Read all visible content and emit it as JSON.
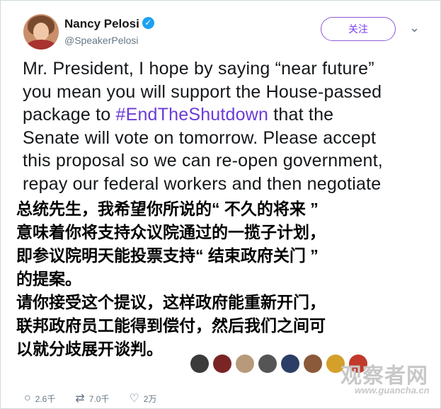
{
  "author": {
    "name": "Nancy Pelosi",
    "handle": "@SpeakerPelosi"
  },
  "follow_label": "关注",
  "tweet": {
    "line1": "Mr. President, I hope by saying “near future”",
    "line2": "you mean you will support the House-passed",
    "line3_pre": "package to ",
    "hashtag": "#EndTheShutdown",
    "line3_post": " that the",
    "line4": "Senate will vote on tomorrow. Please accept",
    "line5": "this proposal so we can re-open government,",
    "line6": "repay our federal workers and then negotiate"
  },
  "translation": [
    "总统先生，我希望你所说的“ 不久的将来 ”",
    "意味着你将支持众议院通过的一揽子计划，",
    "即参议院明天能投票支持“ 结束政府关门 ”",
    "的提案。",
    "请你接受这个提议，这样政府能重新开门，",
    "联邦政府员工能得到偿付，然后我们之间可",
    "以就分歧展开谈判。"
  ],
  "watermark": {
    "main": "观察者网",
    "sub": "www.guancha.cn"
  },
  "actions": {
    "reply_count": "2.6千",
    "retweet_count": "7.0千",
    "like_count": "2万"
  }
}
